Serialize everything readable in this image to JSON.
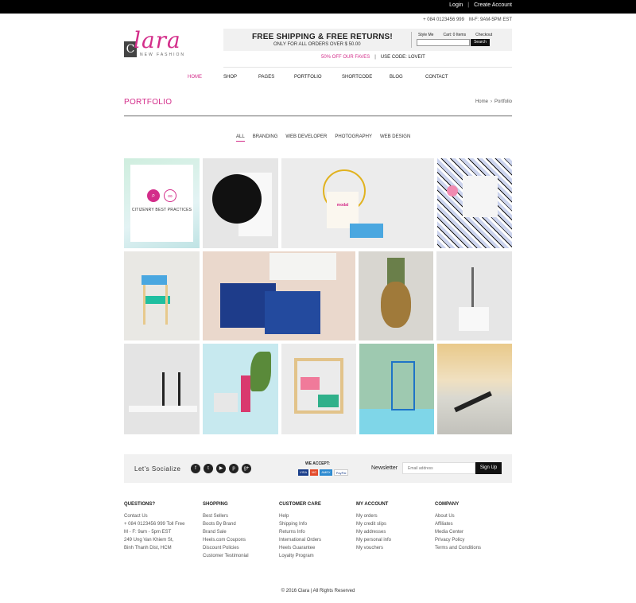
{
  "top_bar": {
    "login": "Login",
    "separator": "|",
    "create_account": "Create Account"
  },
  "contact_row": {
    "phone": "+ 084 0123456 999",
    "hours": "M-F: 9AM-5PM EST"
  },
  "logo": {
    "initial": "C",
    "script": "lara",
    "subtitle": "NEW FASHION"
  },
  "promo": {
    "title": "FREE SHIPPING & FREE RETURNS!",
    "subtitle": "ONLY FOR ALL ORDERS OVER $ 50.00",
    "style_me": "Style Me",
    "cart": "Cart: 0 Items",
    "checkout": "Checkout",
    "search_value": "",
    "search_button": "Search"
  },
  "offer": {
    "text": "50% OFF OUR FAVES",
    "separator": "|",
    "code": "USE CODE: LOVEIT"
  },
  "nav": {
    "items": [
      "HOME",
      "SHOP",
      "PAGES",
      "PORTFOLIO",
      "SHORTCODE",
      "BLOG",
      "CONTACT"
    ],
    "active": "HOME"
  },
  "page": {
    "title": "PORTFOLIO",
    "breadcrumb": [
      "Home",
      "›",
      "Portfolio"
    ]
  },
  "filters": {
    "items": [
      "ALL",
      "BRANDING",
      "WEB DEVELOPER",
      "PHOTOGRAPHY",
      "WEB DESIGN"
    ],
    "active": "ALL"
  },
  "portfolio": {
    "featured_caption": "CITIZENRY BEST PRACTICES",
    "bag_text": "modal",
    "tile_count": 13
  },
  "social": {
    "label": "Let's Socialize",
    "icons": [
      "facebook-icon",
      "twitter-icon",
      "youtube-icon",
      "pinterest-icon",
      "google-plus-icon"
    ],
    "icon_glyphs": [
      "f",
      "t",
      "▶",
      "p",
      "g+"
    ],
    "accept_label": "WE ACCEPT:",
    "cards": [
      "VISA",
      "MC",
      "AMEX",
      "PayPal"
    ],
    "newsletter_label": "Newsletter",
    "newsletter_placeholder": "Email address",
    "signup_button": "Sign Up"
  },
  "footer": {
    "columns": [
      {
        "title": "QUESTIONS?",
        "items": [
          "Contact Us",
          "+ 084 0123456 999 Toll Free",
          "M - F: 9am - 5pm EST",
          "249 Ung Van Khiem St,",
          "Binh Thanh Dist, HCM"
        ]
      },
      {
        "title": "SHOPPING",
        "items": [
          "Best Sellers",
          "Boots By Brand",
          "Brand Sale",
          "Heels.com Coupons",
          "Discount Policies",
          "Customer Testimonial"
        ]
      },
      {
        "title": "CUSTOMER CARE",
        "items": [
          "Help",
          "Shipping Info",
          "Returns Info",
          "International Orders",
          "Heels Guarantee",
          "Loyalty Program"
        ]
      },
      {
        "title": "MY ACCOUNT",
        "items": [
          "My orders",
          "My credit slips",
          "My addresses",
          "My personal info",
          "My vouchers"
        ]
      },
      {
        "title": "COMPANY",
        "items": [
          "About Us",
          "Affiliates",
          "Media Center",
          "Privacy Policy",
          "Terms and Conditions"
        ]
      }
    ],
    "copyright": "© 2016 Clara  |  All Rights Reserved"
  },
  "colors": {
    "accent": "#d32d8a",
    "dark": "#111111",
    "band": "#f1f1f1"
  }
}
